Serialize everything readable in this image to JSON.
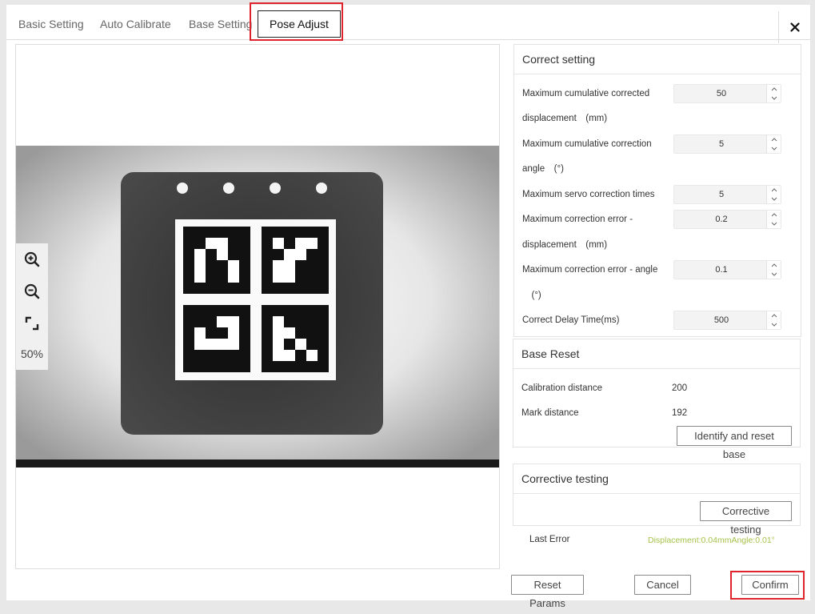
{
  "tabs": [
    {
      "label": "Basic Setting"
    },
    {
      "label": "Auto Calibrate"
    },
    {
      "label": "Base Setting"
    },
    {
      "label": "Pose Adjust"
    }
  ],
  "close_icon": "close-icon",
  "viewer": {
    "zoom_level": "50%",
    "icons": [
      "zoom-in-icon",
      "zoom-out-icon",
      "fit-screen-icon"
    ]
  },
  "correct_setting": {
    "title": "Correct setting",
    "fields": [
      {
        "label_line1": "Maximum cumulative corrected",
        "label_line2": "displacement　(mm)",
        "value": "50"
      },
      {
        "label_line1": "Maximum cumulative correction",
        "label_line2": "angle　(°)",
        "value": "5"
      },
      {
        "label_line1": "Maximum servo correction times",
        "label_line2": "",
        "value": "5"
      },
      {
        "label_line1": "Maximum correction error -",
        "label_line2": "displacement　(mm)",
        "value": "0.2"
      },
      {
        "label_line1": "Maximum correction error - angle",
        "label_line2": "　(°)",
        "value": "0.1"
      },
      {
        "label_line1": "Correct Delay Time(ms)",
        "label_line2": "",
        "value": "500"
      }
    ]
  },
  "base_reset": {
    "title": "Base Reset",
    "calibration_distance_label": "Calibration distance",
    "calibration_distance_value": "200",
    "mark_distance_label": "Mark distance",
    "mark_distance_value": "192",
    "button_label": "Identify and reset base"
  },
  "corrective_testing": {
    "title": "Corrective testing",
    "button_label": "Corrective testing",
    "last_error_label": "Last Error",
    "last_error_value": "Displacement:0.04mmAngle:0.01°"
  },
  "footer": {
    "reset_label": "Reset Params",
    "cancel_label": "Cancel",
    "confirm_label": "Confirm"
  },
  "colors": {
    "highlight": "#e0242b",
    "accent_value": "#a6c24a"
  }
}
